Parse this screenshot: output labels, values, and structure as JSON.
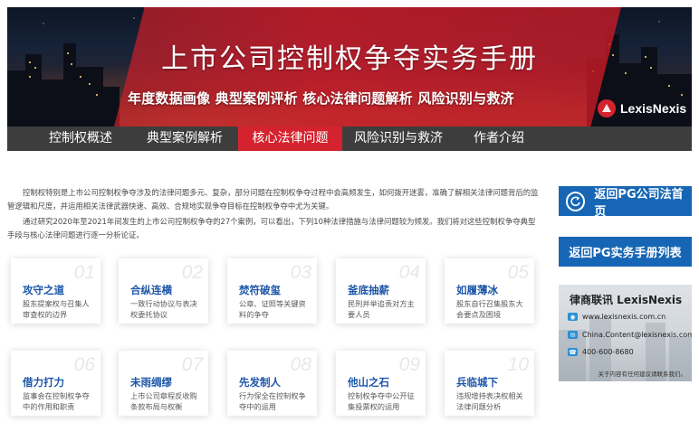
{
  "banner": {
    "title": "上市公司控制权争夺实务手册",
    "subtitle": "年度数据画像 典型案例评析 核心法律问题解析 风险识别与救济",
    "logo_text": "LexisNexis",
    "accent_color": "#d4232e"
  },
  "nav": {
    "items": [
      {
        "label": "控制权概述",
        "active": false
      },
      {
        "label": "典型案例解析",
        "active": false
      },
      {
        "label": "核心法律问题",
        "active": true
      },
      {
        "label": "风险识别与救济",
        "active": false
      },
      {
        "label": "作者介绍",
        "active": false
      }
    ]
  },
  "intro": {
    "p1": "控制权特别是上市公司控制权争夺涉及的法律问题多元、复杂，部分问题在控制权争夺过程中会高频发生，如何拨开迷雾，准确了解相关法律问题背后的监管逻辑和尺度，并运用相关法律武器快速、高效、合规地实现争夺目标在控制权争夺中尤为关键。",
    "p2": "通过研究2020年至2021年间发生的上市公司控制权争夺的27个案例，可以看出，下列10种法律措施与法律问题较为频发。我们将对这些控制权争夺典型手段与核心法律问题进行逐一分析论证。"
  },
  "cards": [
    {
      "num": "01",
      "title": "攻守之道",
      "desc": "股东提案权与召集人审查权的边界"
    },
    {
      "num": "02",
      "title": "合纵连横",
      "desc": "一致行动协议与表决权委托协议"
    },
    {
      "num": "03",
      "title": "焚符破玺",
      "desc": "公章、证照等关键资料的争夺"
    },
    {
      "num": "04",
      "title": "釜底抽薪",
      "desc": "民刑并举追责对方主要人员"
    },
    {
      "num": "05",
      "title": "如履薄冰",
      "desc": "股东自行召集股东大会要点及困境"
    },
    {
      "num": "06",
      "title": "借力打力",
      "desc": "监事会在控制权争夺中的作用和职责"
    },
    {
      "num": "07",
      "title": "未雨绸缪",
      "desc": "上市公司章程反收购条款布局与权衡"
    },
    {
      "num": "08",
      "title": "先发制人",
      "desc": "行为保全在控制权争夺中的运用"
    },
    {
      "num": "09",
      "title": "他山之石",
      "desc": "控制权争夺中公开征集投票权的运用"
    },
    {
      "num": "10",
      "title": "兵临城下",
      "desc": "违规增持表决权相关法律问题分析"
    }
  ],
  "sidebar": {
    "home_label": "返回PG公司法首页",
    "list_label": "返回PG实务手册列表",
    "button_color": "#1666b5",
    "contact": {
      "title": "律商联讯  LexisNexis",
      "website": "www.lexisnexis.com.cn",
      "email": "China.Content@lexisnexis.com",
      "phone": "400-600-8680",
      "note": "关于内容有任何建议请联系我们。"
    }
  }
}
